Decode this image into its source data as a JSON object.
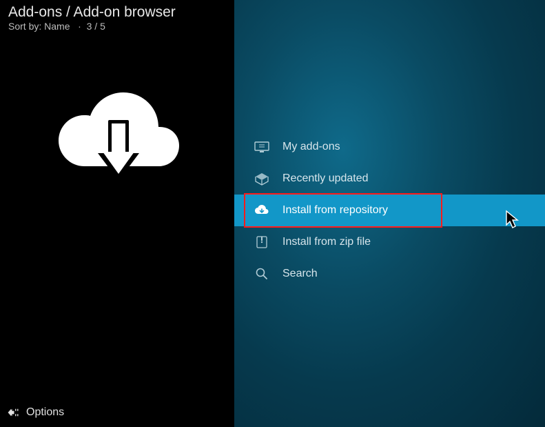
{
  "header": {
    "breadcrumb": "Add-ons / Add-on browser",
    "sort_prefix": "Sort by: ",
    "sort_value": "Name",
    "position": "3 / 5"
  },
  "menu": {
    "items": [
      {
        "label": "My add-ons",
        "icon": "myaddons-icon"
      },
      {
        "label": "Recently updated",
        "icon": "box-icon"
      },
      {
        "label": "Install from repository",
        "icon": "cloud-down-icon"
      },
      {
        "label": "Install from zip file",
        "icon": "zip-icon"
      },
      {
        "label": "Search",
        "icon": "search-icon"
      }
    ],
    "selected_index": 2
  },
  "footer": {
    "options_label": "Options"
  }
}
